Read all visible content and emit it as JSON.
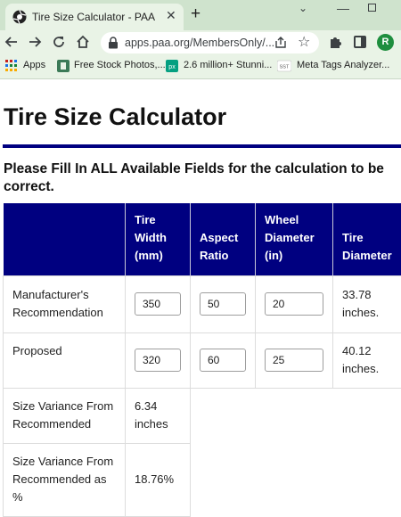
{
  "browser": {
    "tab_title": "Tire Size Calculator - PAA",
    "tab_close": "✕",
    "new_tab": "+",
    "url": "apps.paa.org/MembersOnly/...",
    "avatar_letter": "R",
    "bookmarks": [
      {
        "label": "Apps"
      },
      {
        "label": "Free Stock Photos,..."
      },
      {
        "label": "2.6 million+ Stunni..."
      },
      {
        "label": "Meta Tags Analyzer..."
      }
    ],
    "bookmark_icon_texts": [
      "px",
      "SST"
    ]
  },
  "page": {
    "title": "Tire Size Calculator",
    "instructions": "Please Fill In ALL Available Fields for the calculation to be correct."
  },
  "table": {
    "headers": [
      "",
      "Tire Width (mm)",
      "Aspect Ratio",
      "Wheel Diameter (in)",
      "Tire Diameter"
    ],
    "rows": [
      {
        "label": "Manufacturer's Recommendation",
        "width": "350",
        "aspect": "50",
        "wheel": "20",
        "diameter": "33.78 inches."
      },
      {
        "label": "Proposed",
        "width": "320",
        "aspect": "60",
        "wheel": "25",
        "diameter": "40.12 inches."
      }
    ],
    "variance_label": "Size Variance From Recommended",
    "variance_value": "6.34 inches",
    "variance_pct_label": "Size Variance From Recommended as %",
    "variance_pct_value": "18.76%"
  },
  "colors": {
    "header_bg": "#000080",
    "accent_green": "#1a6b1a",
    "chrome_bg": "#e9f3e6"
  }
}
